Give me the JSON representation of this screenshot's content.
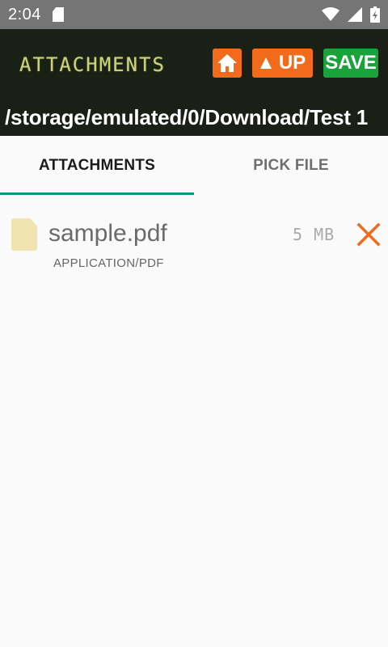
{
  "status_bar": {
    "time": "2:04",
    "icons": [
      "sd-card-icon",
      "wifi-icon",
      "cell-signal-icon",
      "battery-icon"
    ]
  },
  "header": {
    "title": "ATTACHMENTS",
    "home_button": {
      "icon": "home-icon"
    },
    "up_button": {
      "label": "UP",
      "icon": "up-triangle-icon"
    },
    "save_button": {
      "label": "SAVE"
    },
    "path": "/storage/emulated/0/Download/Test 1",
    "colors": {
      "background": "#1a2015",
      "title": "#c9d27a",
      "accent_orange": "#f26a1b",
      "save_green": "#1aa33a"
    }
  },
  "tabs": [
    {
      "label": "ATTACHMENTS",
      "active": true
    },
    {
      "label": "PICK FILE",
      "active": false
    }
  ],
  "attachments": [
    {
      "name": "sample.pdf",
      "mime": "APPLICATION/PDF",
      "size": "5 MB",
      "icon": "file-icon",
      "remove_icon": "close-icon"
    }
  ],
  "accent_color": "#119482"
}
